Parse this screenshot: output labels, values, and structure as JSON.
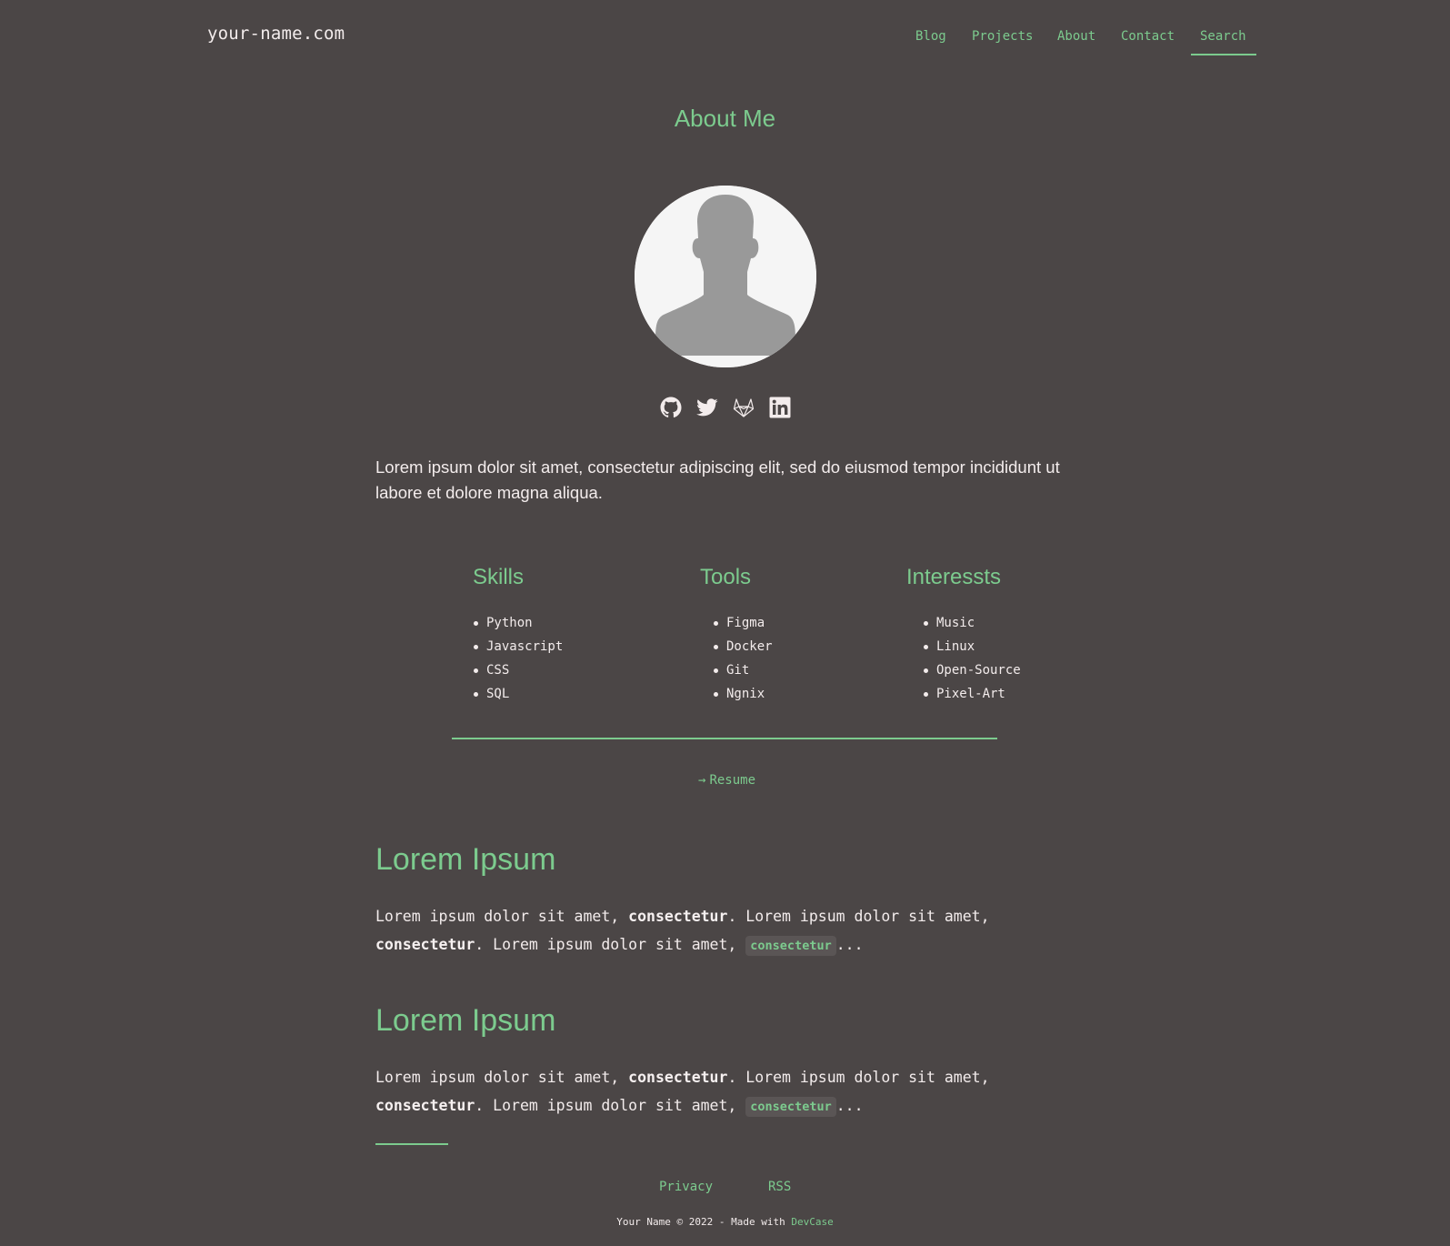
{
  "header": {
    "logo": "your-name.com",
    "nav": [
      {
        "label": "Blog"
      },
      {
        "label": "Projects"
      },
      {
        "label": "About"
      },
      {
        "label": "Contact"
      },
      {
        "label": "Search",
        "active": true
      }
    ]
  },
  "about": {
    "title": "About Me",
    "avatar": "user-silhouette",
    "socials": [
      {
        "name": "github-icon"
      },
      {
        "name": "twitter-icon"
      },
      {
        "name": "gitlab-icon"
      },
      {
        "name": "linkedin-icon"
      }
    ],
    "intro": "Lorem ipsum dolor sit amet, consectetur adipiscing elit, sed do eiusmod tempor incididunt ut labore et dolore magna aliqua.",
    "columns": [
      {
        "title": "Skills",
        "items": [
          "Python",
          "Javascript",
          "CSS",
          "SQL"
        ]
      },
      {
        "title": "Tools",
        "items": [
          "Figma",
          "Docker",
          "Git",
          "Ngnix"
        ]
      },
      {
        "title": "Interessts",
        "items": [
          "Music",
          "Linux",
          "Open-Source",
          "Pixel-Art"
        ]
      }
    ],
    "resume_arrow": "→",
    "resume_label": "Resume"
  },
  "posts": [
    {
      "title": "Lorem Ipsum",
      "p1": "Lorem ipsum dolor sit amet, ",
      "b1": "consectetur",
      "p2": ". Lorem ipsum dolor sit amet, ",
      "b2": "consectetur",
      "p3": ". Lorem ipsum dolor sit amet, ",
      "code": "consectetur",
      "p4": "..."
    },
    {
      "title": "Lorem Ipsum",
      "p1": "Lorem ipsum dolor sit amet, ",
      "b1": "consectetur",
      "p2": ". Lorem ipsum dolor sit amet, ",
      "b2": "consectetur",
      "p3": ". Lorem ipsum dolor sit amet, ",
      "code": "consectetur",
      "p4": "..."
    }
  ],
  "footer": {
    "links": [
      {
        "label": "Privacy"
      },
      {
        "label": "RSS"
      }
    ],
    "copyright_text": "Your Name © 2022 - Made with ",
    "made_with": "DevCase"
  },
  "colors": {
    "background": "#4b4646",
    "accent": "#7ccb8e",
    "text": "#f3ecec"
  }
}
